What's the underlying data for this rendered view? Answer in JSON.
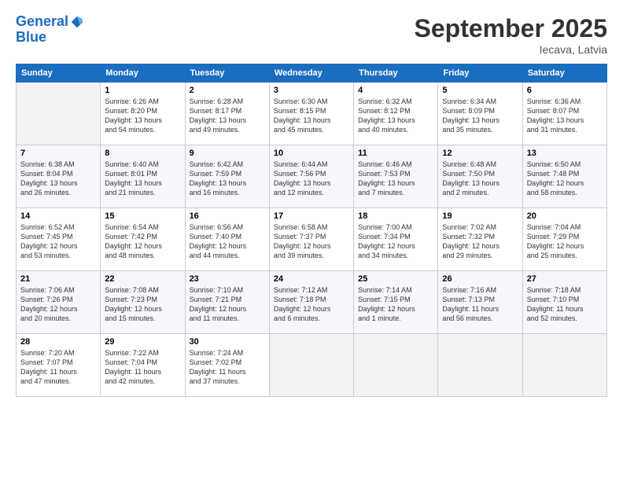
{
  "logo": {
    "line1": "General",
    "line2": "Blue"
  },
  "title": "September 2025",
  "location": "Iecava, Latvia",
  "days_of_week": [
    "Sunday",
    "Monday",
    "Tuesday",
    "Wednesday",
    "Thursday",
    "Friday",
    "Saturday"
  ],
  "weeks": [
    [
      {
        "day": "",
        "info": ""
      },
      {
        "day": "1",
        "info": "Sunrise: 6:26 AM\nSunset: 8:20 PM\nDaylight: 13 hours\nand 54 minutes."
      },
      {
        "day": "2",
        "info": "Sunrise: 6:28 AM\nSunset: 8:17 PM\nDaylight: 13 hours\nand 49 minutes."
      },
      {
        "day": "3",
        "info": "Sunrise: 6:30 AM\nSunset: 8:15 PM\nDaylight: 13 hours\nand 45 minutes."
      },
      {
        "day": "4",
        "info": "Sunrise: 6:32 AM\nSunset: 8:12 PM\nDaylight: 13 hours\nand 40 minutes."
      },
      {
        "day": "5",
        "info": "Sunrise: 6:34 AM\nSunset: 8:09 PM\nDaylight: 13 hours\nand 35 minutes."
      },
      {
        "day": "6",
        "info": "Sunrise: 6:36 AM\nSunset: 8:07 PM\nDaylight: 13 hours\nand 31 minutes."
      }
    ],
    [
      {
        "day": "7",
        "info": "Sunrise: 6:38 AM\nSunset: 8:04 PM\nDaylight: 13 hours\nand 26 minutes."
      },
      {
        "day": "8",
        "info": "Sunrise: 6:40 AM\nSunset: 8:01 PM\nDaylight: 13 hours\nand 21 minutes."
      },
      {
        "day": "9",
        "info": "Sunrise: 6:42 AM\nSunset: 7:59 PM\nDaylight: 13 hours\nand 16 minutes."
      },
      {
        "day": "10",
        "info": "Sunrise: 6:44 AM\nSunset: 7:56 PM\nDaylight: 13 hours\nand 12 minutes."
      },
      {
        "day": "11",
        "info": "Sunrise: 6:46 AM\nSunset: 7:53 PM\nDaylight: 13 hours\nand 7 minutes."
      },
      {
        "day": "12",
        "info": "Sunrise: 6:48 AM\nSunset: 7:50 PM\nDaylight: 13 hours\nand 2 minutes."
      },
      {
        "day": "13",
        "info": "Sunrise: 6:50 AM\nSunset: 7:48 PM\nDaylight: 12 hours\nand 58 minutes."
      }
    ],
    [
      {
        "day": "14",
        "info": "Sunrise: 6:52 AM\nSunset: 7:45 PM\nDaylight: 12 hours\nand 53 minutes."
      },
      {
        "day": "15",
        "info": "Sunrise: 6:54 AM\nSunset: 7:42 PM\nDaylight: 12 hours\nand 48 minutes."
      },
      {
        "day": "16",
        "info": "Sunrise: 6:56 AM\nSunset: 7:40 PM\nDaylight: 12 hours\nand 44 minutes."
      },
      {
        "day": "17",
        "info": "Sunrise: 6:58 AM\nSunset: 7:37 PM\nDaylight: 12 hours\nand 39 minutes."
      },
      {
        "day": "18",
        "info": "Sunrise: 7:00 AM\nSunset: 7:34 PM\nDaylight: 12 hours\nand 34 minutes."
      },
      {
        "day": "19",
        "info": "Sunrise: 7:02 AM\nSunset: 7:32 PM\nDaylight: 12 hours\nand 29 minutes."
      },
      {
        "day": "20",
        "info": "Sunrise: 7:04 AM\nSunset: 7:29 PM\nDaylight: 12 hours\nand 25 minutes."
      }
    ],
    [
      {
        "day": "21",
        "info": "Sunrise: 7:06 AM\nSunset: 7:26 PM\nDaylight: 12 hours\nand 20 minutes."
      },
      {
        "day": "22",
        "info": "Sunrise: 7:08 AM\nSunset: 7:23 PM\nDaylight: 12 hours\nand 15 minutes."
      },
      {
        "day": "23",
        "info": "Sunrise: 7:10 AM\nSunset: 7:21 PM\nDaylight: 12 hours\nand 11 minutes."
      },
      {
        "day": "24",
        "info": "Sunrise: 7:12 AM\nSunset: 7:18 PM\nDaylight: 12 hours\nand 6 minutes."
      },
      {
        "day": "25",
        "info": "Sunrise: 7:14 AM\nSunset: 7:15 PM\nDaylight: 12 hours\nand 1 minute."
      },
      {
        "day": "26",
        "info": "Sunrise: 7:16 AM\nSunset: 7:13 PM\nDaylight: 11 hours\nand 56 minutes."
      },
      {
        "day": "27",
        "info": "Sunrise: 7:18 AM\nSunset: 7:10 PM\nDaylight: 11 hours\nand 52 minutes."
      }
    ],
    [
      {
        "day": "28",
        "info": "Sunrise: 7:20 AM\nSunset: 7:07 PM\nDaylight: 11 hours\nand 47 minutes."
      },
      {
        "day": "29",
        "info": "Sunrise: 7:22 AM\nSunset: 7:04 PM\nDaylight: 11 hours\nand 42 minutes."
      },
      {
        "day": "30",
        "info": "Sunrise: 7:24 AM\nSunset: 7:02 PM\nDaylight: 11 hours\nand 37 minutes."
      },
      {
        "day": "",
        "info": ""
      },
      {
        "day": "",
        "info": ""
      },
      {
        "day": "",
        "info": ""
      },
      {
        "day": "",
        "info": ""
      }
    ]
  ]
}
